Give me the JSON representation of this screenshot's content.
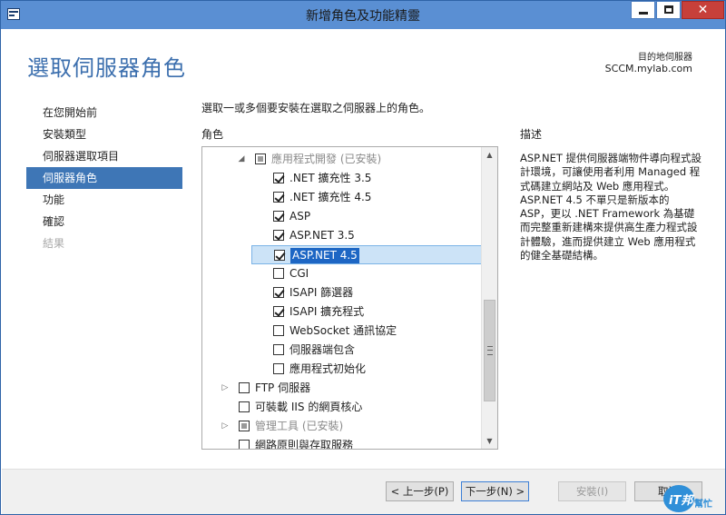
{
  "window": {
    "title": "新增角色及功能精靈",
    "icon": "server-manager-icon",
    "controls": {
      "minimize": "minimize-icon",
      "maximize": "maximize-icon",
      "close": "✕"
    }
  },
  "header": {
    "page_title": "選取伺服器角色",
    "destination_label": "目的地伺服器",
    "destination_server": "SCCM.mylab.com"
  },
  "nav": {
    "items": [
      {
        "label": "在您開始前",
        "state": "normal"
      },
      {
        "label": "安裝類型",
        "state": "normal"
      },
      {
        "label": "伺服器選取項目",
        "state": "normal"
      },
      {
        "label": "伺服器角色",
        "state": "active"
      },
      {
        "label": "功能",
        "state": "normal"
      },
      {
        "label": "確認",
        "state": "normal"
      },
      {
        "label": "結果",
        "state": "disabled"
      }
    ]
  },
  "main": {
    "instruction": "選取一或多個要安裝在選取之伺服器上的角色。",
    "roles_header": "角色",
    "description_header": "描述",
    "roles": [
      {
        "label": "應用程式開發 (已安裝)",
        "checked": "partial",
        "expander": "expanded"
      },
      {
        "label": ".NET 擴充性 3.5",
        "checked": true
      },
      {
        "label": ".NET 擴充性 4.5",
        "checked": true
      },
      {
        "label": "ASP",
        "checked": true
      },
      {
        "label": "ASP.NET 3.5",
        "checked": true
      },
      {
        "label": "ASP.NET 4.5",
        "checked": true,
        "selected": true
      },
      {
        "label": "CGI",
        "checked": false
      },
      {
        "label": "ISAPI 篩選器",
        "checked": true
      },
      {
        "label": "ISAPI 擴充程式",
        "checked": true
      },
      {
        "label": "WebSocket 通訊協定",
        "checked": false
      },
      {
        "label": "伺服器端包含",
        "checked": false
      },
      {
        "label": "應用程式初始化",
        "checked": false
      },
      {
        "label": "FTP 伺服器",
        "checked": false,
        "expander": "collapsed"
      },
      {
        "label": "可裝載 IIS 的網頁核心",
        "checked": false
      },
      {
        "label": "管理工具 (已安裝)",
        "checked": "partial",
        "expander": "collapsed"
      },
      {
        "label": "網路原則與存取服務",
        "checked": false
      }
    ],
    "description": "ASP.NET 提供伺服器端物件導向程式設計環境，可讓使用者利用 Managed 程式碼建立網站及 Web 應用程式。ASP.NET 4.5 不單只是新版本的 ASP，更以 .NET Framework 為基礎而完整重新建構來提供高生產力程式設計體驗，進而提供建立 Web 應用程式的健全基礎結構。"
  },
  "footer": {
    "back_label": "< 上一步(P)",
    "next_label": "下一步(N) >",
    "install_label": "安裝(I)",
    "cancel_label": "取消"
  },
  "watermark": {
    "text": "iT邦",
    "sub": "幫忙"
  },
  "colors": {
    "titlebar": "#5a8fd3",
    "accent": "#3e76b6",
    "selection": "#1d66c4",
    "close": "#c7403a"
  }
}
